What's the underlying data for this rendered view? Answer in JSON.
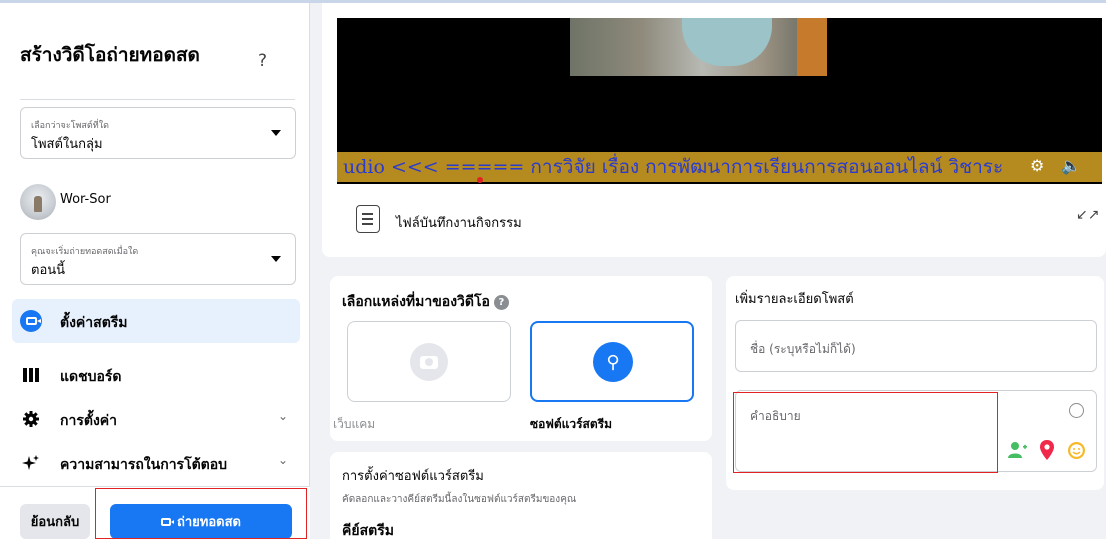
{
  "sidebar": {
    "title": "สร้างวิดีโอถ่ายทอดสด",
    "help_icon": "?",
    "post_where": {
      "label": "เลือกว่าจะโพสต์ที่ใด",
      "value": "โพสต์ในกลุ่ม"
    },
    "user": {
      "name": "Wor-Sor"
    },
    "start_when": {
      "label": "คุณจะเริ่มถ่ายทอดสดเมื่อใด",
      "value": "ตอนนี้"
    },
    "menu": [
      {
        "label": "ตั้งค่าสตรีม",
        "icon": "live-camera-icon",
        "active": true
      },
      {
        "label": "แดชบอร์ด",
        "icon": "dashboard-icon"
      },
      {
        "label": "การตั้งค่า",
        "icon": "gear-icon"
      },
      {
        "label": "ความสามารถในการโต้ตอบ",
        "icon": "sparkle-icon"
      }
    ],
    "back_label": "ย้อนกลับ",
    "go_live_label": "ถ่ายทอดสด"
  },
  "preview": {
    "ticker_text": "udio <<< ===== การวิจัย เรื่อง การพัฒนาการเรียนการสอนออนไลน์ วิชาระ",
    "file_label": "ไฟล์บันทึกงานกิจกรรม"
  },
  "video_source": {
    "title": "เลือกแหล่งที่มาของวิดีโอ",
    "options": [
      {
        "label": "เว็บแคม",
        "selected": false
      },
      {
        "label": "ซอฟต์แวร์สตรีม",
        "selected": true
      }
    ]
  },
  "software_settings": {
    "title": "การตั้งค่าซอฟต์แวร์สตรีม",
    "description": "คัดลอกและวางคีย์สตรีมนี้ลงในซอฟต์แวร์สตรีมของคุณ",
    "stream_key_label": "คีย์สตรีม"
  },
  "post_details": {
    "title": "เพิ่มรายละเอียดโพสต์",
    "name_placeholder": "ชื่อ (ระบุหรือไม่ก็ได้)",
    "description_placeholder": "คำอธิบาย"
  },
  "colors": {
    "accent": "#1877f2",
    "highlight_box": "#e02424"
  }
}
